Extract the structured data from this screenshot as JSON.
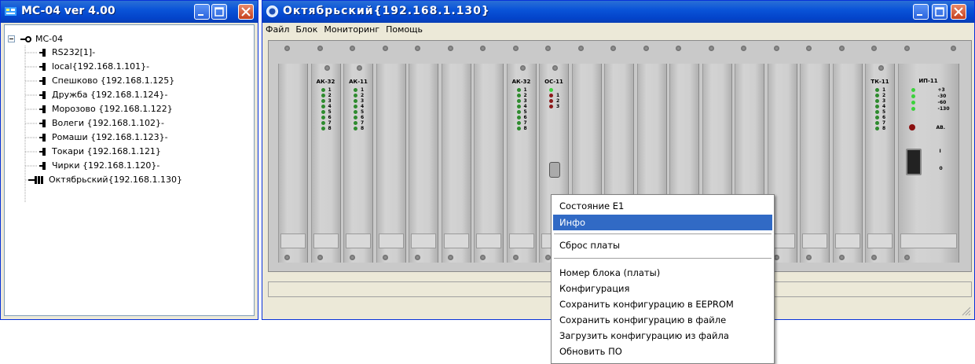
{
  "tree_window": {
    "title": "MC-04  ver 4.00",
    "root": "MC-04",
    "items": [
      {
        "label": "RS232[1]-"
      },
      {
        "label": "local{192.168.1.101}-"
      },
      {
        "label": "Спешково  {192.168.1.125}"
      },
      {
        "label": "Дружба {192.168.1.124}-"
      },
      {
        "label": "Морозово {192.168.1.122}"
      },
      {
        "label": "Волеги {192.168.1.102}-"
      },
      {
        "label": "Ромаши {192.168.1.123}-"
      },
      {
        "label": "Токари {192.168.1.121}"
      },
      {
        "label": "Чирки {192.168.1.120}-"
      },
      {
        "label": "Октябрьский{192.168.1.130}"
      }
    ]
  },
  "main_window": {
    "title": "Октябрьский{192.168.1.130}",
    "menu": [
      "Файл",
      "Блок",
      "Мониторинг",
      "Помощь"
    ]
  },
  "rack": {
    "cards": [
      {
        "name": ""
      },
      {
        "name": "АК-32",
        "led_color": "#2e8b2e",
        "leds": 8
      },
      {
        "name": "АК-11",
        "led_color": "#2e8b2e",
        "leds": 8
      },
      {
        "name": ""
      },
      {
        "name": ""
      },
      {
        "name": ""
      },
      {
        "name": ""
      },
      {
        "name": "АК-32",
        "led_color": "#2e8b2e",
        "leds": 8
      },
      {
        "name": "ОС-11",
        "led_color": "#8b1a1a",
        "leds": 4
      },
      {
        "name": ""
      },
      {
        "name": ""
      },
      {
        "name": ""
      },
      {
        "name": ""
      },
      {
        "name": ""
      },
      {
        "name": ""
      },
      {
        "name": ""
      },
      {
        "name": ""
      },
      {
        "name": ""
      },
      {
        "name": "ТК-11",
        "led_color": "#2e8b2e",
        "leds": 8
      },
      {
        "name": "ИП-11"
      }
    ],
    "power_labels": [
      "+3",
      "-30",
      "-60",
      "-130"
    ],
    "alarm_label": "АВ.",
    "switch_on": "I",
    "switch_off": "0"
  },
  "context_menu": {
    "items": [
      {
        "label": "Состояние E1"
      },
      {
        "label": "Инфо",
        "selected": true
      },
      {
        "label": "Сброс платы"
      },
      {
        "label": "Номер блока (платы)"
      },
      {
        "label": "Конфигурация"
      },
      {
        "label": "Сохранить конфигурацию в EEPROM"
      },
      {
        "label": "Сохранить конфигурацию в файле"
      },
      {
        "label": "Загрузить конфигурацию из файла"
      },
      {
        "label": "Обновить ПО"
      }
    ]
  },
  "colors": {
    "title_bar": "#0a54d8",
    "selection": "#316ac5",
    "window_bg": "#ece9d8"
  }
}
